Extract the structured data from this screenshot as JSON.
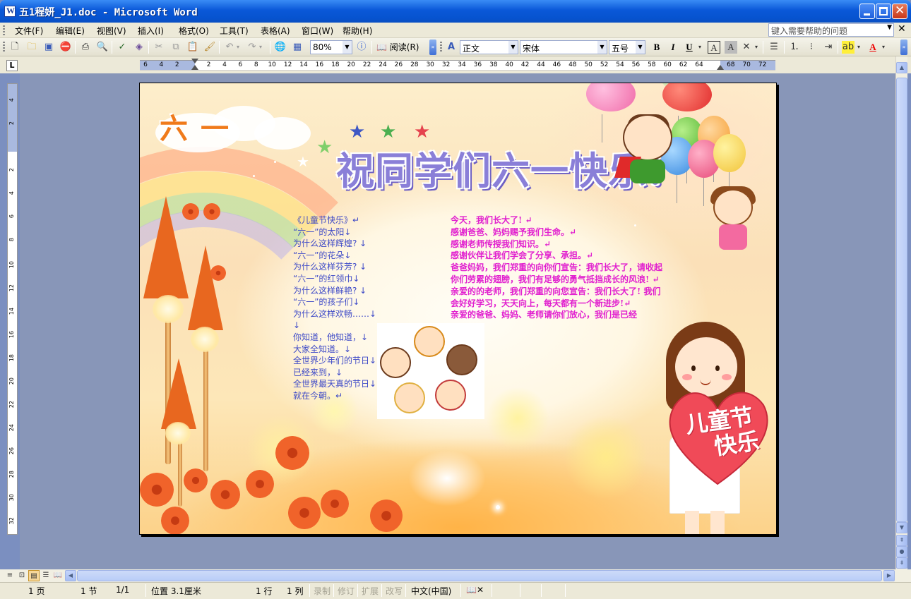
{
  "window": {
    "title": "五1程妍_J1.doc - Microsoft Word"
  },
  "menubar": {
    "items": [
      "文件(F)",
      "编辑(E)",
      "视图(V)",
      "插入(I)",
      "格式(O)",
      "工具(T)",
      "表格(A)",
      "窗口(W)",
      "帮助(H)"
    ],
    "help_placeholder": "键入需要帮助的问题"
  },
  "toolbar": {
    "zoom": "80%",
    "read_label": "阅读(R)",
    "style": "正文",
    "font": "宋体",
    "size": "五号",
    "bold": "B",
    "italic": "I",
    "underline": "U"
  },
  "ruler": {
    "h_ticks": [
      "6",
      "4",
      "2",
      "",
      "2",
      "4",
      "6",
      "8",
      "10",
      "12",
      "14",
      "16",
      "18",
      "20",
      "22",
      "24",
      "26",
      "28",
      "30",
      "32",
      "34",
      "36",
      "38",
      "40",
      "42",
      "44",
      "46",
      "48",
      "50",
      "52",
      "54",
      "56",
      "58",
      "60",
      "62",
      "64",
      "",
      "68",
      "70",
      "72"
    ],
    "v_ticks": [
      "4",
      "2",
      "",
      "2",
      "4",
      "6",
      "8",
      "10",
      "12",
      "14",
      "16",
      "18",
      "20",
      "22",
      "24",
      "26",
      "28",
      "30",
      "32"
    ]
  },
  "poster": {
    "logo_text": "六一",
    "title": "祝同学们六一快乐!",
    "poem": [
      "《儿童节快乐》↵",
      "“六一”的太阳↓",
      "为什么这样辉煌? ↓",
      "“六一”的花朵↓",
      "为什么这样芬芳? ↓",
      "“六一”的红领巾↓",
      "为什么这样鲜艳? ↓",
      "“六一”的孩子们↓",
      "为什么这样欢畅……↓",
      "↓",
      "你知道，他知道，↓",
      "大家全知道。↓",
      "全世界少年们的节日↓",
      "已经来到，↓",
      "全世界最天真的节日↓",
      "就在今朝。↵"
    ],
    "message": [
      "今天，我们长大了! ↵",
      "感谢爸爸、妈妈赐予我们生命。↵",
      "感谢老师传授我们知识。↵",
      "感谢伙伴让我们学会了分享、承担。↵",
      "爸爸妈妈，我们郑重的向你们宣告：我们长大了，请收起你们劳累的翅膀，我们有足够的勇气抵挡成长的风浪! ↵",
      "亲爱的的老师，我们郑重的向您宣告：我们长大了! 我们会好好学习，天天向上，每天都有一个新进步!↵",
      "亲爱的爸爸、妈妈、老师请你们放心，我们是已经"
    ],
    "heart_line1": "儿童节",
    "heart_line2": "快乐"
  },
  "statusbar": {
    "page": "1 页",
    "section": "1 节",
    "page_of": "1/1",
    "position": "位置 3.1厘米",
    "line": "1 行",
    "column": "1 列",
    "rec": "录制",
    "trk": "修订",
    "ext": "扩展",
    "ovr": "改写",
    "language": "中文(中国)"
  },
  "colors": {
    "title_bar": "#0a58d8",
    "chrome": "#ece9d8",
    "workspace": "#8896b8",
    "poem_text": "#3d49c7",
    "message_text": "#e11fcf",
    "title_purple": "#8a7fd8"
  }
}
